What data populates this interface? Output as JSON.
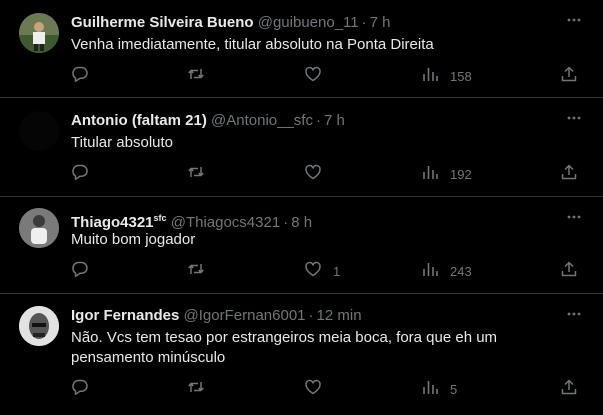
{
  "tweets": [
    {
      "name": "Guilherme Silveira Bueno",
      "badge": "",
      "handle": "@guibueno_11",
      "time": "7 h",
      "text": "Venha imediatamente, titular absoluto na Ponta Direita",
      "replies": "",
      "retweets": "",
      "likes": "",
      "views": "158"
    },
    {
      "name": "Antonio (faltam 21)",
      "badge": "",
      "handle": "@Antonio__sfc",
      "time": "7 h",
      "text": "Titular absoluto",
      "replies": "",
      "retweets": "",
      "likes": "",
      "views": "192"
    },
    {
      "name": "Thiago4321",
      "badge": "sfc",
      "handle": "@Thiagocs4321",
      "time": "8 h",
      "text": "Muito bom jogador",
      "replies": "",
      "retweets": "",
      "likes": "1",
      "views": "243"
    },
    {
      "name": "Igor Fernandes",
      "badge": "",
      "handle": "@IgorFernan6001",
      "time": "12 min",
      "text": "Não. Vcs tem tesao por estrangeiros meia boca, fora que eh um pensamento minúsculo",
      "replies": "",
      "retweets": "",
      "likes": "",
      "views": "5"
    }
  ],
  "separator": "·",
  "colors": {
    "background": "#000000",
    "text": "#e7e9ea",
    "muted": "#71767b",
    "border": "#2f3336"
  },
  "icons": [
    "reply-icon",
    "retweet-icon",
    "like-icon",
    "views-icon",
    "share-icon",
    "more-icon"
  ]
}
